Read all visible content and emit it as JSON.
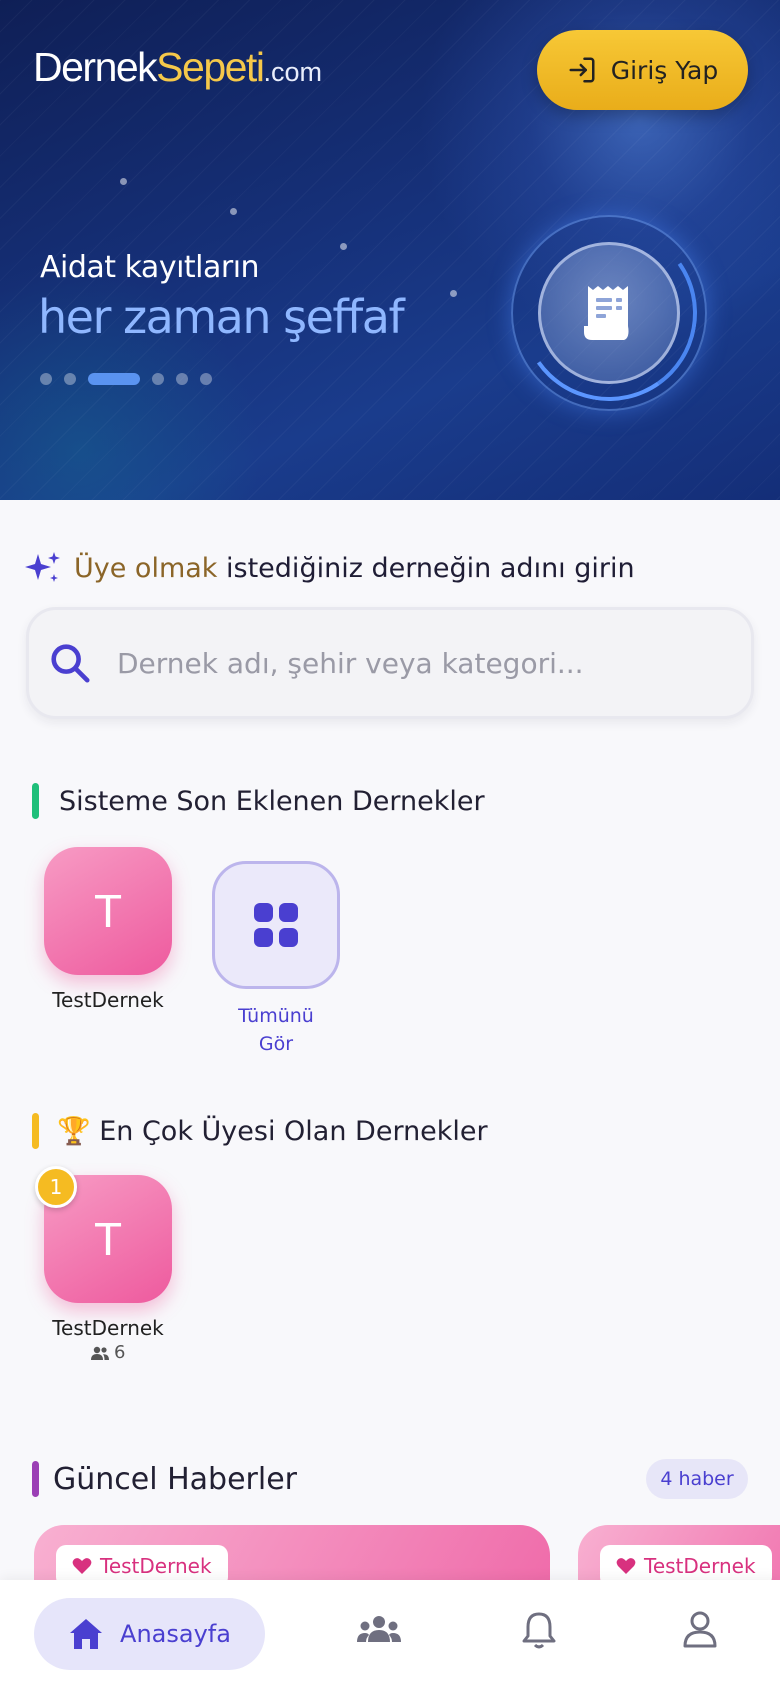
{
  "header": {
    "logo_part1": "Dernek",
    "logo_part2": "Sepeti",
    "logo_part3": ".com",
    "login_label": "Giriş Yap"
  },
  "hero": {
    "subtitle": "Aidat kayıtların",
    "title": "her zaman şeffaf",
    "slide_count": 6,
    "active_slide": 3,
    "icon": "receipt-icon"
  },
  "search": {
    "prompt_highlight": "Üye olmak",
    "prompt_rest": "istediğiniz derneğin adını girin",
    "placeholder": "Dernek adı, şehir veya kategori..."
  },
  "recent": {
    "title": "Sisteme Son Eklenen Dernekler",
    "accent": "#1fbf7a",
    "items": [
      {
        "initial": "T",
        "name": "TestDernek"
      }
    ],
    "see_all_line1": "Tümünü",
    "see_all_line2": "Gör"
  },
  "top_members": {
    "title": "🏆 En Çok Üyesi Olan Dernekler",
    "accent": "#f5bb22",
    "items": [
      {
        "rank": "1",
        "initial": "T",
        "name": "TestDernek",
        "members": "6"
      }
    ]
  },
  "news": {
    "title": "Güncel Haberler",
    "accent": "#9b3fb5",
    "count_label": "4 haber",
    "cards": [
      {
        "tag": "TestDernek"
      },
      {
        "tag": "TestDernek"
      }
    ]
  },
  "bottom_nav": {
    "home_label": "Anasayfa",
    "items": [
      "home-icon",
      "groups-icon",
      "bell-icon",
      "profile-icon"
    ]
  }
}
